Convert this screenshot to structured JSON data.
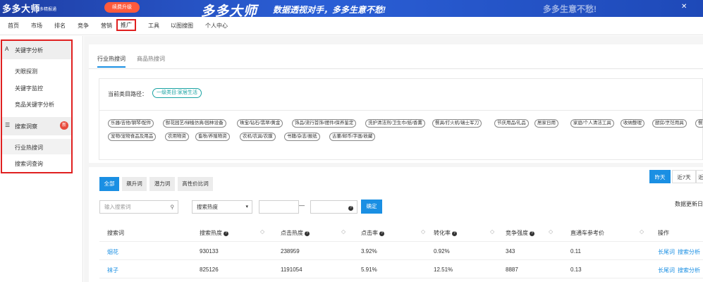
{
  "banner": {
    "logo": "多多大师",
    "logo_sub": "多多精报通",
    "upgrade_label": "续费升级",
    "brand": "多多大师",
    "slogan": "数据透视对手，多多生意不愁!",
    "faint_text": "多多生意不愁!",
    "close_icon": "close-icon",
    "colors": {
      "banner": "#2b5fd6",
      "upgrade": "#ff5a3c"
    }
  },
  "nav": {
    "items": [
      "首页",
      "市场",
      "排名",
      "竞争",
      "营销",
      "推广",
      "工具",
      "以图搜图",
      "个人中心"
    ],
    "active": "推广"
  },
  "sidebar": {
    "sections": [
      {
        "icon": "A",
        "title": "关键字分析",
        "items": [
          "天眼探测",
          "关键字监控",
          "竞品关键字分析"
        ]
      },
      {
        "icon": "filter-icon",
        "title": "搜索洞察",
        "badge": "新",
        "items": [
          "行业热搜词",
          "搜索词查询"
        ],
        "active_item": "行业热搜词"
      }
    ]
  },
  "tabs": [
    "行业热搜词",
    "商品热搜词"
  ],
  "category": {
    "path_label": "当前类目路径：",
    "path_value": "一级类目:家居生活",
    "chips_row1": [
      "乐器/吉他/钢琴/配件",
      "鲜花园艺/绿植仿真/园林设备",
      "珠宝/钻石/翡翠/黄金",
      "饰品/流行首饰/摆件/保养鉴定",
      "洗护清洁剂/卫生巾/纸/香薰",
      "餐具/打火机/瑞士军刀",
      "节庆用品/礼品",
      "居家日用",
      "家庭/个人清洁工具",
      "收纳整理",
      "厨房/烹饪用具",
      "餐"
    ],
    "chips_row2": [
      "宠物/宠物食品及用品",
      "农用物资",
      "畜牧/养殖物资",
      "农机/农具/农膜",
      "书籍/杂志/报纸",
      "古董/邮币/字画/收藏"
    ]
  },
  "filters": {
    "word_tabs": [
      "全部",
      "飙升词",
      "潜力词",
      "高性价比词"
    ],
    "active_tab": "全部",
    "search_placeholder": "输入搜索词",
    "sort_select": "搜索热度",
    "range_dash": "—",
    "confirm_label": "确定",
    "day_buttons": [
      "昨天",
      "近7天",
      "近"
    ],
    "active_day": "昨天",
    "update_text": "数据更新日"
  },
  "table": {
    "headers": [
      "搜索词",
      "搜索热度",
      "点击热度",
      "点击率",
      "转化率",
      "竞争强度",
      "直通车参考价",
      "操作"
    ],
    "rows": [
      {
        "word": "烟花",
        "search": "930133",
        "click": "238959",
        "ctr": "3.92%",
        "cvr": "0.92%",
        "compete": "343",
        "price": "0.11",
        "ops": [
          "长尾词",
          "搜索分析"
        ]
      },
      {
        "word": "袜子",
        "search": "825126",
        "click": "1191054",
        "ctr": "5.91%",
        "cvr": "12.51%",
        "compete": "8887",
        "price": "0.13",
        "ops": [
          "长尾词",
          "搜索分析"
        ]
      }
    ]
  }
}
